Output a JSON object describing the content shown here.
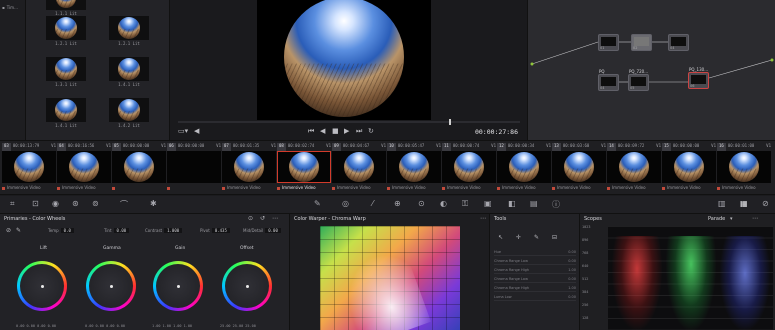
{
  "gallery": {
    "sidebar_label": "Tim...",
    "stills": [
      "1.1.1 Lit",
      "1.2.1 Lit",
      "1.2.1 Lit",
      "1.3.1 Lit",
      "1.4.1 Lit",
      "1.4.1 Lit",
      "1.4.2 Lit"
    ]
  },
  "viewer": {
    "timecode": "00:00:27:86"
  },
  "nodes": [
    {
      "label": "",
      "num": "01"
    },
    {
      "label": "",
      "num": "02"
    },
    {
      "label": "",
      "num": "04"
    },
    {
      "label": "PQ",
      "num": "04"
    },
    {
      "label": "PQ_720...",
      "num": "05"
    },
    {
      "label": "PQ_130...",
      "num": "06"
    }
  ],
  "clips": [
    {
      "num": "03",
      "tc": "00:00:13:79",
      "v": "V1",
      "name": "Immersive Video"
    },
    {
      "num": "04",
      "tc": "00:00:16:56",
      "v": "V1",
      "name": "Immersive Video"
    },
    {
      "num": "05",
      "tc": "00:00:00:00",
      "v": "V1",
      "name": ""
    },
    {
      "num": "06",
      "tc": "00:00:00:00",
      "v": "V1",
      "name": ""
    },
    {
      "num": "07",
      "tc": "00:00:01:35",
      "v": "V1",
      "name": "Immersive Video"
    },
    {
      "num": "08",
      "tc": "00:00:02:74",
      "v": "V1",
      "name": "Immersive Video"
    },
    {
      "num": "09",
      "tc": "00:00:04:67",
      "v": "V1",
      "name": "Immersive Video"
    },
    {
      "num": "10",
      "tc": "00:00:05:47",
      "v": "V1",
      "name": "Immersive Video"
    },
    {
      "num": "11",
      "tc": "00:00:00:74",
      "v": "V1",
      "name": "Immersive Video"
    },
    {
      "num": "12",
      "tc": "00:00:00:34",
      "v": "V1",
      "name": "Immersive Video"
    },
    {
      "num": "13",
      "tc": "00:00:03:60",
      "v": "V1",
      "name": "Immersive Video"
    },
    {
      "num": "14",
      "tc": "00:00:09:72",
      "v": "V1",
      "name": "Immersive Video"
    },
    {
      "num": "15",
      "tc": "00:00:00:00",
      "v": "V1",
      "name": "Immersive Video"
    },
    {
      "num": "16",
      "tc": "00:00:01:00",
      "v": "V1",
      "name": "Immersive Video"
    }
  ],
  "primaries": {
    "title": "Primaries - Color Wheels",
    "params": [
      {
        "label": "Temp",
        "value": "0.0"
      },
      {
        "label": "Tint",
        "value": "0.00"
      },
      {
        "label": "Contrast",
        "value": "1.000"
      },
      {
        "label": "Pivot",
        "value": "0.435"
      },
      {
        "label": "Mid/Detail",
        "value": "0.00"
      }
    ],
    "wheels": [
      {
        "label": "Lift",
        "values": "0.00  0.00  0.00  0.00"
      },
      {
        "label": "Gamma",
        "values": "0.00  0.00  0.00  0.00"
      },
      {
        "label": "Gain",
        "values": "1.00  1.00  1.00  1.00"
      },
      {
        "label": "Offset",
        "values": "25.00  25.00  25.00"
      }
    ]
  },
  "warper": {
    "title": "Color Warper - Chroma Warp"
  },
  "tools": {
    "title": "Tools",
    "rows": [
      "Hue",
      "Chroma Range Low",
      "Chroma Range High",
      "Chroma Range Low",
      "Chroma Range High",
      "Luma Low"
    ]
  },
  "scopes": {
    "title": "Scopes",
    "mode": "Parade",
    "ticks": [
      "1023",
      "896",
      "768",
      "640",
      "512",
      "384",
      "256",
      "128"
    ]
  }
}
